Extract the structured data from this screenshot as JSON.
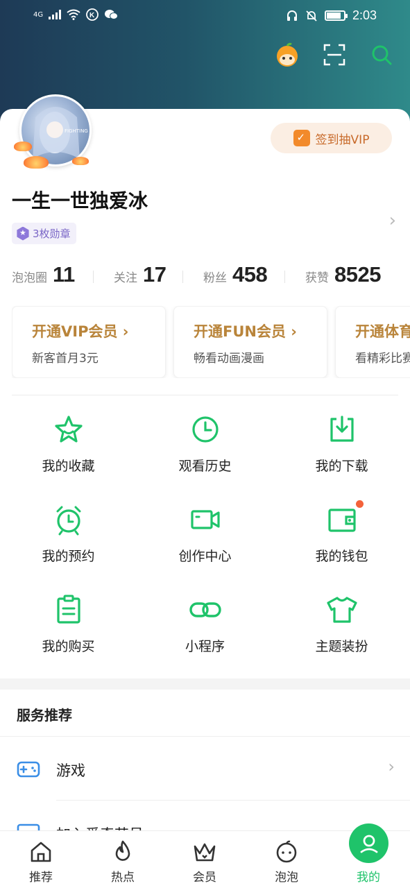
{
  "status_bar": {
    "network": "4G",
    "time": "2:03",
    "battery_level": 0.85
  },
  "header": {
    "icons": [
      "mascot-icon",
      "scan-icon",
      "search-icon"
    ]
  },
  "profile": {
    "avatar_tag": "FIGHTING",
    "checkin_label": "签到抽VIP",
    "username": "一生一世独爱冰",
    "medal_label": "3枚勋章"
  },
  "stats": [
    {
      "label": "泡泡圈",
      "value": "11"
    },
    {
      "label": "关注",
      "value": "17"
    },
    {
      "label": "粉丝",
      "value": "458"
    },
    {
      "label": "获赞",
      "value": "8525"
    }
  ],
  "promos": [
    {
      "title": "开通VIP会员 ›",
      "subtitle": "新客首月3元"
    },
    {
      "title": "开通FUN会员 ›",
      "subtitle": "畅看动画漫画"
    },
    {
      "title": "开通体育",
      "subtitle": "看精彩比赛"
    }
  ],
  "grid": [
    {
      "label": "我的收藏",
      "icon": "star-icon"
    },
    {
      "label": "观看历史",
      "icon": "clock-icon"
    },
    {
      "label": "我的下载",
      "icon": "download-icon"
    },
    {
      "label": "我的预约",
      "icon": "alarm-icon"
    },
    {
      "label": "创作中心",
      "icon": "camera-icon"
    },
    {
      "label": "我的钱包",
      "icon": "wallet-icon",
      "badge": true
    },
    {
      "label": "我的购买",
      "icon": "clipboard-icon"
    },
    {
      "label": "小程序",
      "icon": "link-icon"
    },
    {
      "label": "主题装扮",
      "icon": "shirt-icon"
    }
  ],
  "services": {
    "title": "服务推荐",
    "items": [
      {
        "label": "游戏",
        "icon": "gamepad-icon"
      },
      {
        "label": "加入爱奇艺号",
        "icon": "tv-icon"
      }
    ]
  },
  "nav": [
    {
      "label": "推荐",
      "icon": "home-icon"
    },
    {
      "label": "热点",
      "icon": "flame-icon"
    },
    {
      "label": "会员",
      "icon": "crown-icon"
    },
    {
      "label": "泡泡",
      "icon": "bubble-face-icon"
    },
    {
      "label": "我的",
      "icon": "profile-icon",
      "active": true
    }
  ],
  "colors": {
    "accent": "#1fc36a",
    "promo_text": "#b9843a",
    "medal": "#7b67c7",
    "badge": "#f4623a"
  }
}
